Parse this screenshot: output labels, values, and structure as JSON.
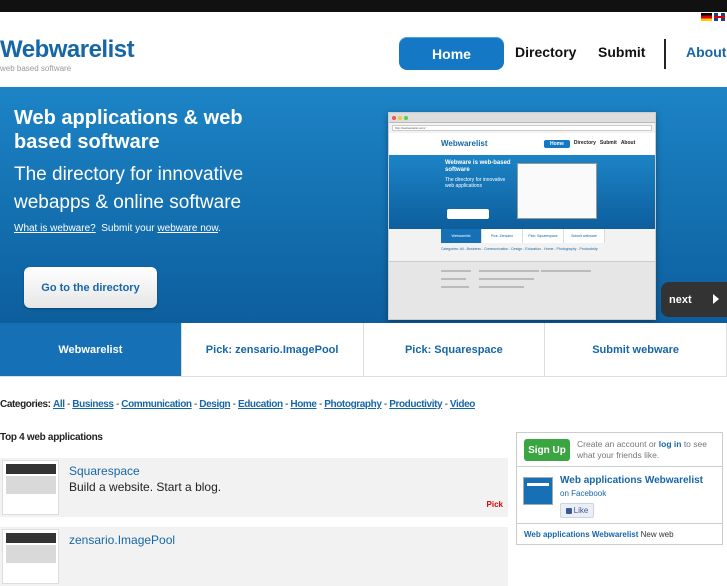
{
  "header": {
    "logo": "Webwarelist",
    "tagline": "web based software",
    "languages": [
      "de-flag-icon",
      "en-flag-icon"
    ]
  },
  "nav": {
    "home": "Home",
    "directory": "Directory",
    "submit": "Submit",
    "about": "About"
  },
  "hero": {
    "title": "Web applications & web based software",
    "subtitle": "The directory for innovative webapps & online software",
    "what_link": "What is webware?",
    "submit_text": "Submit your",
    "submit_link": "webware now",
    "submit_end": ".",
    "cta": "Go to the directory",
    "next": "next",
    "preview": {
      "url": "http://webwarelist.com/",
      "logo": "Webwarelist",
      "nav": [
        "Home",
        "Directory",
        "Submit",
        "About"
      ],
      "hero_title": "Webware is web-based software",
      "hero_sub": "The directory for innovative web applications",
      "tabs": [
        "Webwarelist",
        "Pick: Zensario",
        "Pick: Squarespace",
        "Submit webware"
      ],
      "cats": "Categories: All - Business - Communication - Design - Education - Home - Photography - Productivity"
    }
  },
  "tabs": [
    "Webwarelist",
    "Pick: zensario.ImagePool",
    "Pick: Squarespace",
    "Submit webware"
  ],
  "categories": {
    "label": "Categories:",
    "items": [
      "All",
      "Business",
      "Communication",
      "Design",
      "Education",
      "Home",
      "Photography",
      "Productivity",
      "Video"
    ]
  },
  "top4": {
    "heading": "Top 4 web applications",
    "apps": [
      {
        "title": "Squarespace",
        "desc": "Build a website. Start a blog.",
        "badge": "Pick"
      },
      {
        "title": "zensario.ImagePool",
        "desc": "",
        "badge": ""
      }
    ]
  },
  "sidebar": {
    "signup": "Sign Up",
    "signup_text_1": "Create an account or",
    "login": "log in",
    "signup_text_2": "to see what your friends like.",
    "fb_title": "Web applications Webwarelist",
    "fb_sub": "on Facebook",
    "like": "Like",
    "footer_bold": "Web applications Webwarelist",
    "footer_text": "New web"
  },
  "colors": {
    "brand": "#1766a8",
    "hero": "#1670b5",
    "signup": "#3aa541",
    "pick": "#dd0000"
  }
}
